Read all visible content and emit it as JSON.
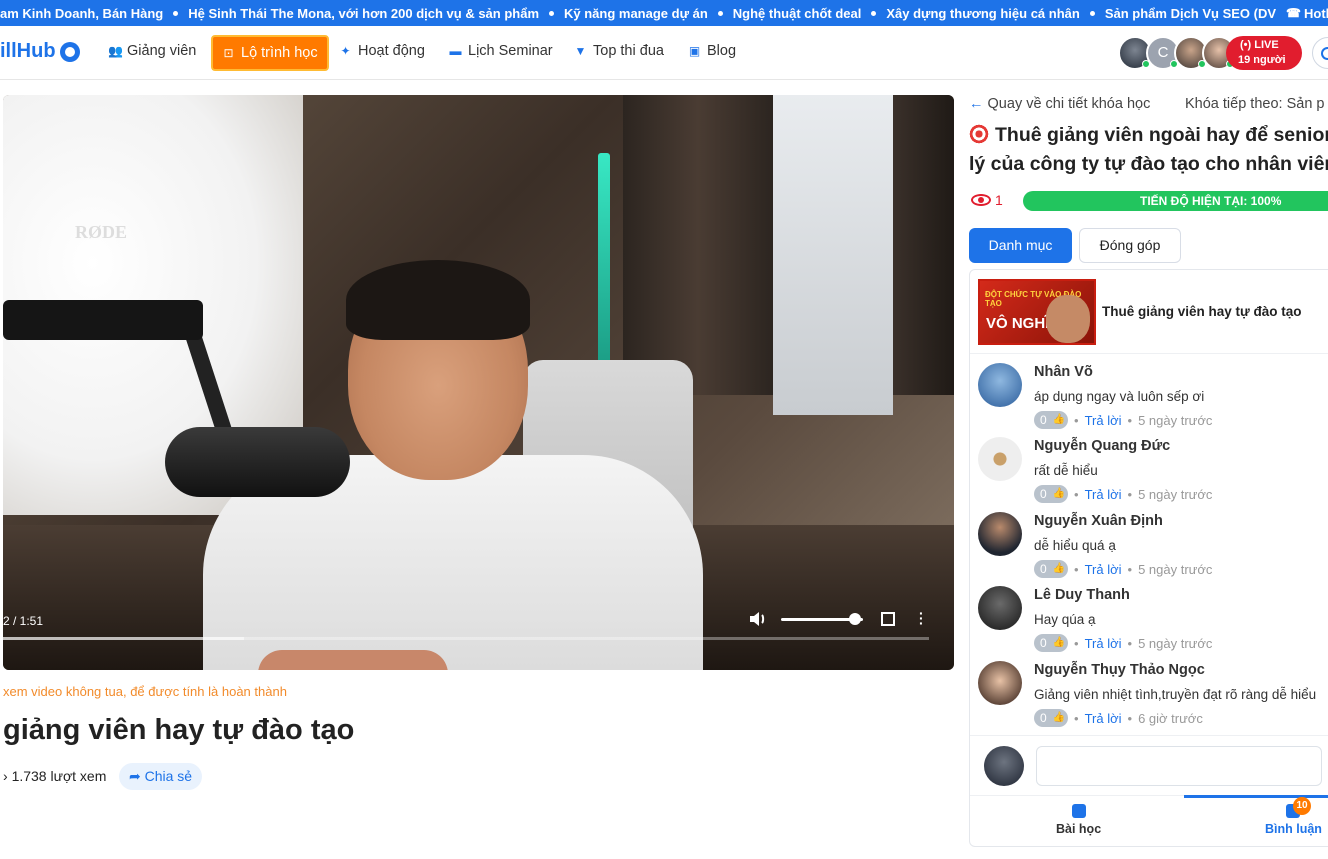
{
  "ticker": {
    "items": [
      "am Kinh Doanh, Bán Hàng",
      "Hệ Sinh Thái The Mona, với hơn 200 dịch vụ & sản phẩm",
      "Kỹ năng manage dự án",
      "Nghệ thuật chốt deal",
      "Xây dựng thương hiệu cá nhân",
      "Sản phẩm Dịch Vụ SEO (DV"
    ],
    "hotline": "Hotline kỳ"
  },
  "nav": {
    "logo": "illHub",
    "items": [
      {
        "label": "Giảng viên",
        "icon": "users-icon"
      },
      {
        "label": "Lộ trình học",
        "icon": "map-icon"
      },
      {
        "label": "Hoạt động",
        "icon": "megaphone-icon"
      },
      {
        "label": "Lịch Seminar",
        "icon": "book-icon"
      },
      {
        "label": "Top thi đua",
        "icon": "trophy-icon"
      },
      {
        "label": "Blog",
        "icon": "blog-icon"
      }
    ],
    "avatar_initial": "C",
    "live": {
      "label": "LIVE",
      "count": "19 người"
    }
  },
  "video": {
    "time": "2 / 1:51",
    "brand_text": "RØDE",
    "progress": 0.26,
    "volume": 0.9
  },
  "note": "xem video không tua, để được tính là hoàn thành",
  "lesson_title": "giảng viên hay tự đào tạo",
  "views": "1.738 lượt xem",
  "share_label": "Chia sẻ",
  "sidebar": {
    "back_label": "Quay về chi tiết khóa học",
    "next_label": "Khóa tiếp theo: Sản p",
    "course_title_line1": "Thuê giảng viên ngoài hay để senior",
    "course_title_line2": "lý của công ty tự đào tạo cho nhân viên",
    "view_count": "1",
    "progress_label": "TIẾN ĐỘ HIỆN TẠI: 100%",
    "progress_value": 1.0,
    "tabs": [
      "Danh mục",
      "Đóng góp"
    ],
    "lesson": {
      "thumb_top": "ĐỘT CHỨC TỰ VÀO ĐÀO TẠO",
      "thumb_big": "VÔ NGHĨA",
      "title": "Thuê giảng viên hay tự đào tạo"
    },
    "comments": [
      {
        "name": "Nhân Võ",
        "text": "áp dụng ngay và luôn sếp ơi",
        "likes": "0",
        "reply": "Trả lời",
        "time": "5 ngày trước"
      },
      {
        "name": "Nguyễn Quang Đức",
        "text": "rất dễ hiểu",
        "likes": "0",
        "reply": "Trả lời",
        "time": "5 ngày trước"
      },
      {
        "name": "Nguyễn Xuân Định",
        "text": "dễ hiểu quá ạ",
        "likes": "0",
        "reply": "Trả lời",
        "time": "5 ngày trước"
      },
      {
        "name": "Lê Duy Thanh",
        "text": "Hay qúa ạ",
        "likes": "0",
        "reply": "Trả lời",
        "time": "5 ngày trước"
      },
      {
        "name": "Nguyễn Thụy Thảo Ngọc",
        "text": "Giảng viên nhiệt tình,truyền đạt rõ ràng dễ hiểu",
        "likes": "0",
        "reply": "Trả lời",
        "time": "6 giờ trước"
      }
    ],
    "bottom_tabs": [
      "Bài học",
      "Bình luận"
    ],
    "comment_badge": "10"
  },
  "colors": {
    "brand": "#1e73e8",
    "accent": "#ff7a00",
    "live": "#e11d2e",
    "progress": "#22c55e"
  }
}
